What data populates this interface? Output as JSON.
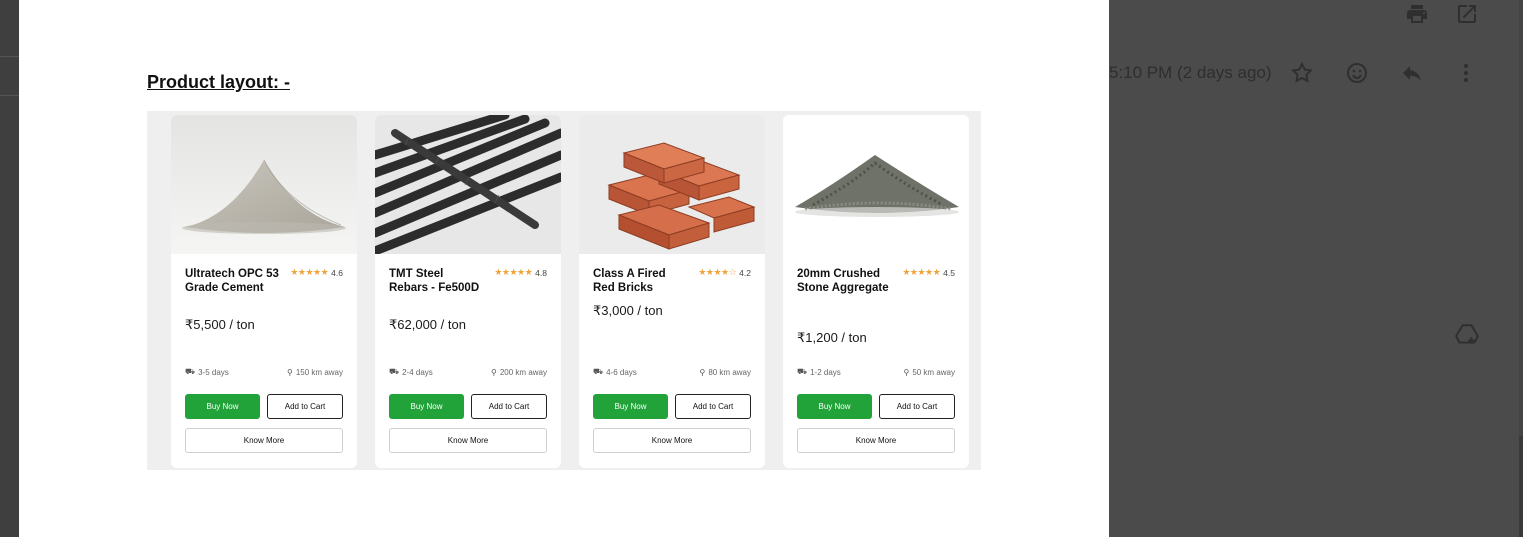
{
  "background": {
    "received_time": "5:10 PM (2 days ago)",
    "icons": [
      "print-icon",
      "open-in-new-icon",
      "star-icon",
      "emoji-icon",
      "reply-icon",
      "more-vert-icon",
      "add-to-drive-icon"
    ]
  },
  "document": {
    "heading": "Product layout: -"
  },
  "products": [
    {
      "title": "Ultratech OPC 53 Grade Cement",
      "rating": "4.6",
      "stars": "★★★★★",
      "price": "₹5,500 / ton",
      "delivery": "3-5 days",
      "distance": "150 km away",
      "buy_label": "Buy Now",
      "cart_label": "Add to Cart",
      "know_label": "Know More"
    },
    {
      "title": "TMT Steel Rebars - Fe500D",
      "rating": "4.8",
      "stars": "★★★★★",
      "price": "₹62,000 / ton",
      "delivery": "2-4 days",
      "distance": "200 km away",
      "buy_label": "Buy Now",
      "cart_label": "Add to Cart",
      "know_label": "Know More"
    },
    {
      "title": "Class A Fired Red Bricks",
      "rating": "4.2",
      "stars": "★★★★☆",
      "price": "₹3,000 / ton",
      "delivery": "4-6 days",
      "distance": "80 km away",
      "buy_label": "Buy Now",
      "cart_label": "Add to Cart",
      "know_label": "Know More"
    },
    {
      "title": "20mm Crushed Stone Aggregate",
      "rating": "4.5",
      "stars": "★★★★★",
      "price": "₹1,200 / ton",
      "delivery": "1-2 days",
      "distance": "50 km away",
      "buy_label": "Buy Now",
      "cart_label": "Add to Cart",
      "know_label": "Know More"
    }
  ],
  "colors": {
    "buy_button": "#21a33a",
    "star": "#f2a23b"
  }
}
